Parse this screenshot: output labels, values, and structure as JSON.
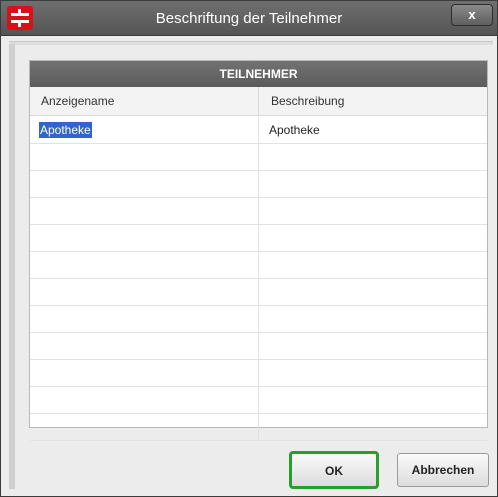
{
  "window": {
    "title": "Beschriftung der Teilnehmer",
    "close_label": "x"
  },
  "table": {
    "title": "TEILNEHMER",
    "columns": [
      "Anzeigename",
      "Beschreibung"
    ],
    "rows": [
      [
        "Apotheke",
        "Apotheke"
      ],
      [
        "",
        ""
      ],
      [
        "",
        ""
      ],
      [
        "",
        ""
      ],
      [
        "",
        ""
      ],
      [
        "",
        ""
      ],
      [
        "",
        ""
      ],
      [
        "",
        ""
      ],
      [
        "",
        ""
      ],
      [
        "",
        ""
      ],
      [
        "",
        ""
      ],
      [
        "",
        ""
      ]
    ],
    "selected_row": 0
  },
  "buttons": {
    "ok": "OK",
    "cancel": "Abbrechen"
  },
  "colors": {
    "app_icon": "#d9101a",
    "selection": "#3265c9",
    "ok_border": "#27a02a"
  }
}
